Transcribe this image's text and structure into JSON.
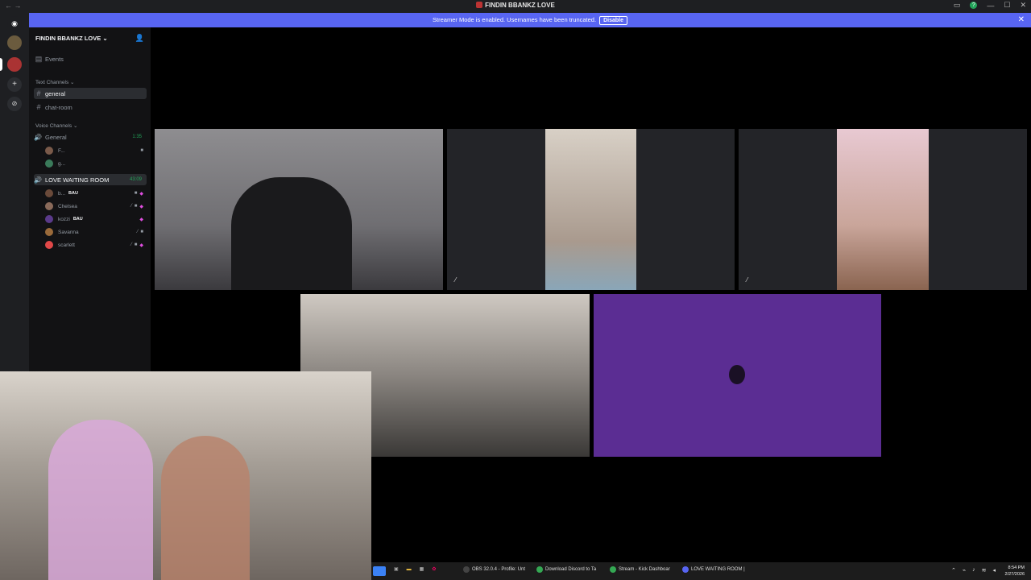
{
  "window": {
    "title": "FINDIN BBANKZ LOVE",
    "nav_arrows": "← →"
  },
  "banner": {
    "message": "Streamer Mode is enabled. Usernames have been truncated.",
    "button": "Disable",
    "close": "✕"
  },
  "server": {
    "name": "FINDIN BBANKZ LOVE",
    "chevron": "⌄"
  },
  "sidebar": {
    "events_label": "Events",
    "text_category": "Text Channels",
    "text_channels": [
      "general",
      "chat-room"
    ],
    "voice_category": "Voice Channels",
    "voice_channels": [
      {
        "name": "General",
        "time": "1:35",
        "members": [
          "F...",
          "g..."
        ]
      },
      {
        "name": "LOVE WAITING ROOM",
        "time": "43:09",
        "members": [
          "b...",
          "Chelsea",
          "kozzi",
          "Savanna",
          "scarlett"
        ]
      }
    ],
    "badges": [
      "BAU",
      "BAU"
    ]
  },
  "taskbar": {
    "tasks": [
      "OBS 32.0.4 - Profile: Unt",
      "Download Discord to Ta",
      "Stream - Kick Dashboar",
      "LOVE WAITING ROOM |"
    ],
    "time": "8:54 PM",
    "date": "2/27/2026"
  },
  "icons": {
    "mic": "mic-muted-icon",
    "video": "video-icon",
    "speaker": "speaker-icon"
  }
}
